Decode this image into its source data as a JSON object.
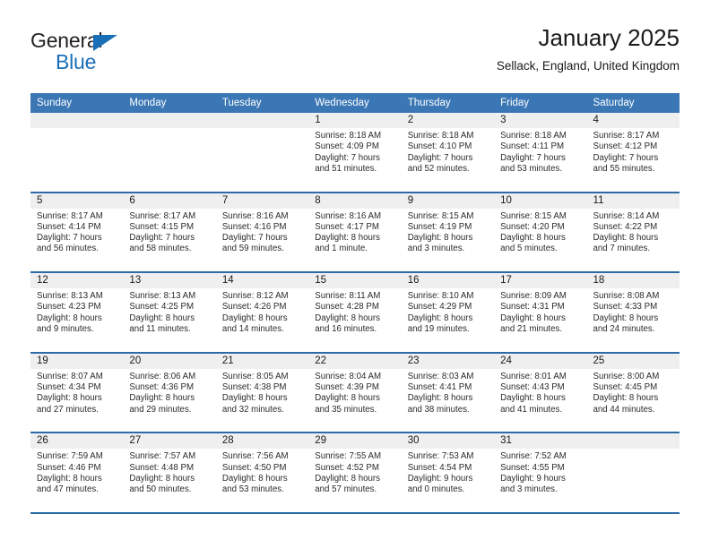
{
  "brand": {
    "name_top": "General",
    "name_bottom": "Blue",
    "triangle_color": "#1a70b8"
  },
  "header": {
    "title": "January 2025",
    "subtitle": "Sellack, England, United Kingdom"
  },
  "colors": {
    "header_blue": "#3b77b5",
    "row_divider_blue": "#2b6ca8",
    "day_band_gray": "#efefef"
  },
  "weekdays": [
    "Sunday",
    "Monday",
    "Tuesday",
    "Wednesday",
    "Thursday",
    "Friday",
    "Saturday"
  ],
  "labels": {
    "sunrise": "Sunrise:",
    "sunset": "Sunset:",
    "daylight": "Daylight:"
  },
  "weeks": [
    [
      {
        "day": ""
      },
      {
        "day": ""
      },
      {
        "day": ""
      },
      {
        "day": "1",
        "sunrise": "Sunrise: 8:18 AM",
        "sunset": "Sunset: 4:09 PM",
        "daylight_1": "Daylight: 7 hours",
        "daylight_2": "and 51 minutes."
      },
      {
        "day": "2",
        "sunrise": "Sunrise: 8:18 AM",
        "sunset": "Sunset: 4:10 PM",
        "daylight_1": "Daylight: 7 hours",
        "daylight_2": "and 52 minutes."
      },
      {
        "day": "3",
        "sunrise": "Sunrise: 8:18 AM",
        "sunset": "Sunset: 4:11 PM",
        "daylight_1": "Daylight: 7 hours",
        "daylight_2": "and 53 minutes."
      },
      {
        "day": "4",
        "sunrise": "Sunrise: 8:17 AM",
        "sunset": "Sunset: 4:12 PM",
        "daylight_1": "Daylight: 7 hours",
        "daylight_2": "and 55 minutes."
      }
    ],
    [
      {
        "day": "5",
        "sunrise": "Sunrise: 8:17 AM",
        "sunset": "Sunset: 4:14 PM",
        "daylight_1": "Daylight: 7 hours",
        "daylight_2": "and 56 minutes."
      },
      {
        "day": "6",
        "sunrise": "Sunrise: 8:17 AM",
        "sunset": "Sunset: 4:15 PM",
        "daylight_1": "Daylight: 7 hours",
        "daylight_2": "and 58 minutes."
      },
      {
        "day": "7",
        "sunrise": "Sunrise: 8:16 AM",
        "sunset": "Sunset: 4:16 PM",
        "daylight_1": "Daylight: 7 hours",
        "daylight_2": "and 59 minutes."
      },
      {
        "day": "8",
        "sunrise": "Sunrise: 8:16 AM",
        "sunset": "Sunset: 4:17 PM",
        "daylight_1": "Daylight: 8 hours",
        "daylight_2": "and 1 minute."
      },
      {
        "day": "9",
        "sunrise": "Sunrise: 8:15 AM",
        "sunset": "Sunset: 4:19 PM",
        "daylight_1": "Daylight: 8 hours",
        "daylight_2": "and 3 minutes."
      },
      {
        "day": "10",
        "sunrise": "Sunrise: 8:15 AM",
        "sunset": "Sunset: 4:20 PM",
        "daylight_1": "Daylight: 8 hours",
        "daylight_2": "and 5 minutes."
      },
      {
        "day": "11",
        "sunrise": "Sunrise: 8:14 AM",
        "sunset": "Sunset: 4:22 PM",
        "daylight_1": "Daylight: 8 hours",
        "daylight_2": "and 7 minutes."
      }
    ],
    [
      {
        "day": "12",
        "sunrise": "Sunrise: 8:13 AM",
        "sunset": "Sunset: 4:23 PM",
        "daylight_1": "Daylight: 8 hours",
        "daylight_2": "and 9 minutes."
      },
      {
        "day": "13",
        "sunrise": "Sunrise: 8:13 AM",
        "sunset": "Sunset: 4:25 PM",
        "daylight_1": "Daylight: 8 hours",
        "daylight_2": "and 11 minutes."
      },
      {
        "day": "14",
        "sunrise": "Sunrise: 8:12 AM",
        "sunset": "Sunset: 4:26 PM",
        "daylight_1": "Daylight: 8 hours",
        "daylight_2": "and 14 minutes."
      },
      {
        "day": "15",
        "sunrise": "Sunrise: 8:11 AM",
        "sunset": "Sunset: 4:28 PM",
        "daylight_1": "Daylight: 8 hours",
        "daylight_2": "and 16 minutes."
      },
      {
        "day": "16",
        "sunrise": "Sunrise: 8:10 AM",
        "sunset": "Sunset: 4:29 PM",
        "daylight_1": "Daylight: 8 hours",
        "daylight_2": "and 19 minutes."
      },
      {
        "day": "17",
        "sunrise": "Sunrise: 8:09 AM",
        "sunset": "Sunset: 4:31 PM",
        "daylight_1": "Daylight: 8 hours",
        "daylight_2": "and 21 minutes."
      },
      {
        "day": "18",
        "sunrise": "Sunrise: 8:08 AM",
        "sunset": "Sunset: 4:33 PM",
        "daylight_1": "Daylight: 8 hours",
        "daylight_2": "and 24 minutes."
      }
    ],
    [
      {
        "day": "19",
        "sunrise": "Sunrise: 8:07 AM",
        "sunset": "Sunset: 4:34 PM",
        "daylight_1": "Daylight: 8 hours",
        "daylight_2": "and 27 minutes."
      },
      {
        "day": "20",
        "sunrise": "Sunrise: 8:06 AM",
        "sunset": "Sunset: 4:36 PM",
        "daylight_1": "Daylight: 8 hours",
        "daylight_2": "and 29 minutes."
      },
      {
        "day": "21",
        "sunrise": "Sunrise: 8:05 AM",
        "sunset": "Sunset: 4:38 PM",
        "daylight_1": "Daylight: 8 hours",
        "daylight_2": "and 32 minutes."
      },
      {
        "day": "22",
        "sunrise": "Sunrise: 8:04 AM",
        "sunset": "Sunset: 4:39 PM",
        "daylight_1": "Daylight: 8 hours",
        "daylight_2": "and 35 minutes."
      },
      {
        "day": "23",
        "sunrise": "Sunrise: 8:03 AM",
        "sunset": "Sunset: 4:41 PM",
        "daylight_1": "Daylight: 8 hours",
        "daylight_2": "and 38 minutes."
      },
      {
        "day": "24",
        "sunrise": "Sunrise: 8:01 AM",
        "sunset": "Sunset: 4:43 PM",
        "daylight_1": "Daylight: 8 hours",
        "daylight_2": "and 41 minutes."
      },
      {
        "day": "25",
        "sunrise": "Sunrise: 8:00 AM",
        "sunset": "Sunset: 4:45 PM",
        "daylight_1": "Daylight: 8 hours",
        "daylight_2": "and 44 minutes."
      }
    ],
    [
      {
        "day": "26",
        "sunrise": "Sunrise: 7:59 AM",
        "sunset": "Sunset: 4:46 PM",
        "daylight_1": "Daylight: 8 hours",
        "daylight_2": "and 47 minutes."
      },
      {
        "day": "27",
        "sunrise": "Sunrise: 7:57 AM",
        "sunset": "Sunset: 4:48 PM",
        "daylight_1": "Daylight: 8 hours",
        "daylight_2": "and 50 minutes."
      },
      {
        "day": "28",
        "sunrise": "Sunrise: 7:56 AM",
        "sunset": "Sunset: 4:50 PM",
        "daylight_1": "Daylight: 8 hours",
        "daylight_2": "and 53 minutes."
      },
      {
        "day": "29",
        "sunrise": "Sunrise: 7:55 AM",
        "sunset": "Sunset: 4:52 PM",
        "daylight_1": "Daylight: 8 hours",
        "daylight_2": "and 57 minutes."
      },
      {
        "day": "30",
        "sunrise": "Sunrise: 7:53 AM",
        "sunset": "Sunset: 4:54 PM",
        "daylight_1": "Daylight: 9 hours",
        "daylight_2": "and 0 minutes."
      },
      {
        "day": "31",
        "sunrise": "Sunrise: 7:52 AM",
        "sunset": "Sunset: 4:55 PM",
        "daylight_1": "Daylight: 9 hours",
        "daylight_2": "and 3 minutes."
      },
      {
        "day": ""
      }
    ]
  ]
}
